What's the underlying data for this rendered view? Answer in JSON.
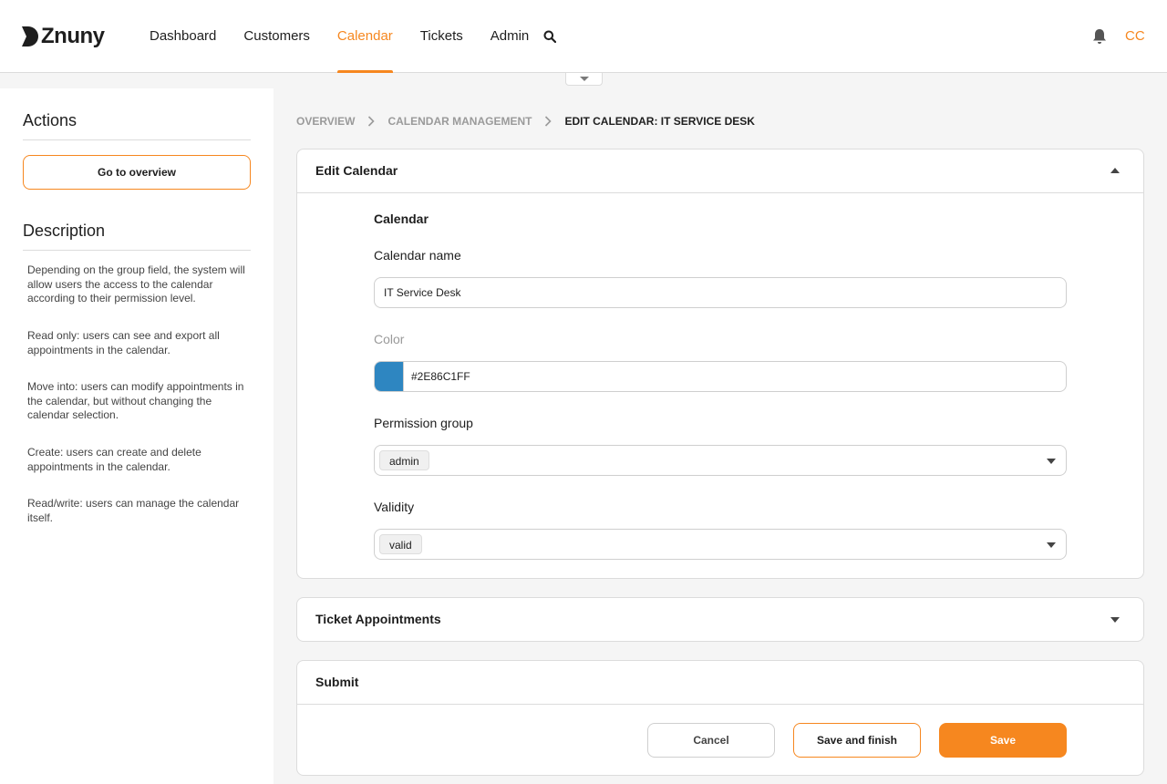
{
  "brand": {
    "name": "Znuny",
    "accent_color": "#f6871f"
  },
  "nav": {
    "items": [
      {
        "label": "Dashboard",
        "active": false
      },
      {
        "label": "Customers",
        "active": false
      },
      {
        "label": "Calendar",
        "active": true
      },
      {
        "label": "Tickets",
        "active": false
      },
      {
        "label": "Admin",
        "active": false
      }
    ],
    "search_icon": "search-icon",
    "notification_icon": "bell-icon",
    "user_initials": "CC"
  },
  "sidebar": {
    "actions_title": "Actions",
    "overview_button": "Go to overview",
    "description_title": "Description",
    "description": [
      "Depending on the group field, the system will allow users the access to the calendar according to their permission level.",
      "Read only: users can see and export all appointments in the calendar.",
      "Move into: users can modify appointments in the calendar, but without changing the calendar selection.",
      "Create: users can create and delete appointments in the calendar.",
      "Read/write: users can manage the calendar itself."
    ]
  },
  "breadcrumb": [
    "Overview",
    "Calendar Management",
    "Edit Calendar: IT Service Desk"
  ],
  "edit_panel": {
    "title": "Edit Calendar",
    "section_title": "Calendar",
    "name_label": "Calendar name",
    "name_value": "IT Service Desk",
    "color_label": "Color",
    "color_value": "#2E86C1FF",
    "color_swatch": "#2e86c1",
    "group_label": "Permission group",
    "group_value": "admin",
    "validity_label": "Validity",
    "validity_value": "valid"
  },
  "ticket_panel": {
    "title": "Ticket Appointments"
  },
  "submit_panel": {
    "title": "Submit",
    "cancel": "Cancel",
    "save_finish": "Save and finish",
    "save": "Save"
  }
}
